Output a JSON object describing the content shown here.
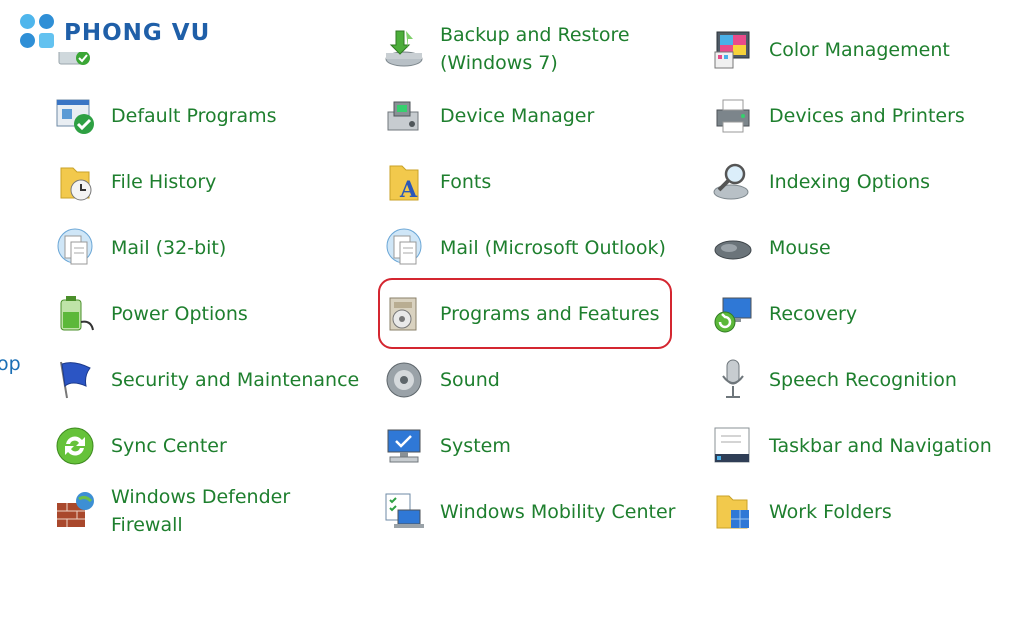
{
  "brand": {
    "name": "PHONG VU"
  },
  "side_fragment": "op",
  "items": {
    "backup_restore": "Backup and Restore (Windows 7)",
    "color_management": "Color Management",
    "default_programs": "Default Programs",
    "device_manager": "Device Manager",
    "devices_printers": "Devices and Printers",
    "file_history": "File History",
    "fonts": "Fonts",
    "indexing_options": "Indexing Options",
    "mail_32": "Mail (32-bit)",
    "mail_outlook": "Mail (Microsoft Outlook)",
    "mouse": "Mouse",
    "power_options": "Power Options",
    "programs_features": "Programs and Features",
    "recovery": "Recovery",
    "security_maintenance": "Security and Maintenance",
    "sound": "Sound",
    "speech_recognition": "Speech Recognition",
    "sync_center": "Sync Center",
    "system": "System",
    "taskbar_navigation": "Taskbar and Navigation",
    "defender_firewall": "Windows Defender Firewall",
    "mobility_center": "Windows Mobility Center",
    "work_folders": "Work Folders"
  },
  "colors": {
    "link_green": "#1e7f2e",
    "highlight_red": "#d42630",
    "brand_blue": "#1f5fa8"
  }
}
